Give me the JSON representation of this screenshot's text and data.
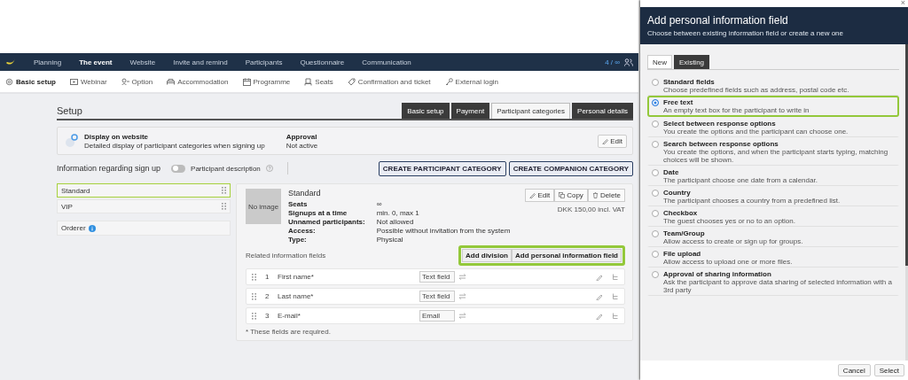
{
  "top_nav": {
    "items": [
      {
        "label": "Planning",
        "selected": false
      },
      {
        "label": "The event",
        "selected": true
      },
      {
        "label": "Website",
        "selected": false
      },
      {
        "label": "Invite and remind",
        "selected": false
      },
      {
        "label": "Participants",
        "selected": false
      },
      {
        "label": "Questionnaire",
        "selected": false
      },
      {
        "label": "Communication",
        "selected": false
      }
    ],
    "counter": "4 / ∞"
  },
  "sub_nav": {
    "items": [
      {
        "label": "Basic setup",
        "selected": true
      },
      {
        "label": "Webinar",
        "selected": false
      },
      {
        "label": "Option",
        "selected": false
      },
      {
        "label": "Accommodation",
        "selected": false
      },
      {
        "label": "Programme",
        "selected": false
      },
      {
        "label": "Seats",
        "selected": false
      },
      {
        "label": "Confirmation and ticket",
        "selected": false
      },
      {
        "label": "External login",
        "selected": false
      }
    ]
  },
  "setup": {
    "title": "Setup",
    "tabs": [
      {
        "label": "Basic setup",
        "selected": false
      },
      {
        "label": "Payment",
        "selected": false
      },
      {
        "label": "Participant categories",
        "selected": true
      },
      {
        "label": "Personal details",
        "selected": false
      }
    ],
    "website": {
      "title": "Display on website",
      "description": "Detailed display of participant categories when signing up",
      "approval_label": "Approval",
      "approval_value": "Not active",
      "edit": "Edit"
    },
    "signup": {
      "title": "Information regarding sign up",
      "toggle_label": "Participant description",
      "on": false
    },
    "buttons": [
      "CREATE PARTICIPANT CATEGORY",
      "CREATE COMPANION CATEGORY"
    ]
  },
  "categories": [
    {
      "label": "Standard",
      "selected": true
    },
    {
      "label": "VIP",
      "selected": false
    }
  ],
  "orderer": {
    "label": "Orderer"
  },
  "category": {
    "image_label": "No image",
    "title": "Standard",
    "actions": [
      "Edit",
      "Copy",
      "Delete"
    ],
    "price": "DKK 150,00 incl. VAT",
    "properties": [
      {
        "name": "Seats",
        "value": "∞"
      },
      {
        "name": "Signups at a time",
        "value": "min. 0, max 1"
      },
      {
        "name": "Unnamed participants:",
        "value": "Not allowed"
      },
      {
        "name": "Access:",
        "value": "Possible without invitation from the system"
      },
      {
        "name": "Type:",
        "value": "Physical"
      }
    ],
    "related_label": "Related information fields",
    "buttons": [
      "Add division",
      "Add personal information field"
    ],
    "buttons_highlighted": true,
    "fields": [
      {
        "number": "1",
        "name": "First name*",
        "type": "Text field"
      },
      {
        "number": "2",
        "name": "Last name*",
        "type": "Text field"
      },
      {
        "number": "3",
        "name": "E-mail*",
        "type": "Email"
      }
    ],
    "footnote": "* These fields are required."
  },
  "dialog": {
    "close": "×",
    "title": "Add personal information field",
    "subtitle": "Choose between existing information field or create a new one",
    "tabs": [
      {
        "label": "New",
        "selected": true
      },
      {
        "label": "Existing",
        "selected": false
      }
    ],
    "options": [
      {
        "label": "Standard fields",
        "description": "Choose predefined fields such as address, postal code etc.",
        "selected": false
      },
      {
        "label": "Free text",
        "description": "An empty text box for the participant to write in",
        "selected": true
      },
      {
        "label": "Select between response options",
        "description": "You create the options and the participant can choose one.",
        "selected": false
      },
      {
        "label": "Search between response options",
        "description": "You create the options, and when the participant starts typing, matching choices will be shown.",
        "selected": false
      },
      {
        "label": "Date",
        "description": "The participant choose one date from a calendar.",
        "selected": false
      },
      {
        "label": "Country",
        "description": "The participant chooses a country from a predefined list.",
        "selected": false
      },
      {
        "label": "Checkbox",
        "description": "The guest chooses yes or no to an option.",
        "selected": false
      },
      {
        "label": "Team/Group",
        "description": "Allow access to create or sign up for groups.",
        "selected": false
      },
      {
        "label": "File upload",
        "description": "Allow access to upload one or more files.",
        "selected": false
      },
      {
        "label": "Approval of sharing information",
        "description": "Ask the participant to approve data sharing of selected information with a 3rd party",
        "selected": false
      }
    ],
    "buttons": [
      "Cancel",
      "Select"
    ]
  }
}
